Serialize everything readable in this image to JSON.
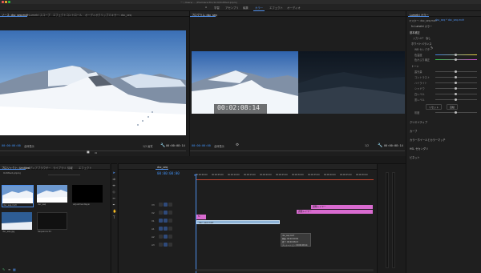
{
  "titlebar": {
    "title": "ー / Users/ ... /Premiere Pro/12.0/Untitled.prproj"
  },
  "workspaces": [
    {
      "label": "学習",
      "active": false
    },
    {
      "label": "アセンブリ",
      "active": false
    },
    {
      "label": "編集",
      "active": false
    },
    {
      "label": "カラー",
      "active": true
    },
    {
      "label": "エフェクト",
      "active": false
    },
    {
      "label": "オーディオ",
      "active": false
    }
  ],
  "source_panel": {
    "tabs": [
      "ソース: dsc_seq.mxfr",
      "Lumetri スコープ",
      "エフェクトコントロール",
      "オーディオクリップミキサー: dsc_seq"
    ],
    "timecode_in": "00:00:00:00",
    "fit_label": "全体表示",
    "timecode_out": "00:00:08:14",
    "zoom_label": "1/2 画質"
  },
  "program_panel": {
    "tabs": [
      "プログラム: dsc_seq"
    ],
    "overlay_timecode": "00:02:08:14",
    "timecode_in": "00:00:00:00",
    "fit_label": "全体表示",
    "zoom_label": "1/2",
    "timecode_out": "00:00:08:14"
  },
  "lumetri_panel": {
    "title": "Lumetri カラー",
    "source_label": "マスター: dsc_seq.mxfr",
    "clip_label": "dsc_seq * dsc_seq.mxfr",
    "fx_label": "fx Lumetri カラー",
    "section_basic": "基本補正",
    "lut_label": "入力 LUT",
    "lut_value": "なし",
    "white_balance": "ホワイトバランス",
    "wb_selector": "WB セレクター",
    "temp": "色温度",
    "tint": "色かぶり補正",
    "tone": "トーン",
    "exposure": "露光量",
    "contrast": "コントラスト",
    "highlights": "ハイライト",
    "shadows": "シャドウ",
    "whites": "白レベル",
    "blacks": "黒レベル",
    "reset": "リセット",
    "auto": "自動",
    "saturation": "彩度",
    "sections": [
      "クリエイティブ",
      "カーブ",
      "カラーホイールとカラーマッチ",
      "HSL セカンダリ",
      "ビネット"
    ]
  },
  "project_panel": {
    "tabs": [
      "プロジェクト: Untitled",
      "メディアブラウザー",
      "ライブラリ",
      "情報",
      "エフェクト"
    ],
    "path": "Untitled.prproj",
    "items": [
      {
        "name": "dsc_seq.mxfr",
        "duration": "8:14"
      },
      {
        "name": "dsc_seq",
        "duration": "8:14"
      },
      {
        "name": "adjustmentlayer",
        "duration": ""
      },
      {
        "name": "dsc_seq.jpg",
        "duration": ""
      },
      {
        "name": "Sequence 01",
        "duration": ""
      }
    ],
    "search_placeholder": ""
  },
  "timeline": {
    "tab": "dsc_seq",
    "timecode": "00:00:00:00",
    "ruler": [
      "00:00:00:00",
      "00:00:05:00",
      "00:00:10:00",
      "00:00:15:00",
      "00:00:20:00",
      "00:00:25:00",
      "00:00:30:00",
      "00:00:35:00",
      "00:00:40:00",
      "00:00:45:00",
      "00:00:50:00"
    ],
    "tracks": [
      "V3",
      "V2",
      "V1",
      "A1",
      "A2",
      "A3"
    ],
    "clips": [
      {
        "label": "fx",
        "track": "V2"
      },
      {
        "label": "dsc_seq.mxfr",
        "track": "V1"
      },
      {
        "label": "調整レイヤー",
        "track": "V3"
      },
      {
        "label": "調整レイヤー",
        "track": "V2"
      }
    ],
    "tooltip": [
      "dsc_seq.mxfr",
      "開始: 00:00:00:00",
      "終了: 00:00:08:13",
      "デュレーション: 00:00:08:14"
    ]
  },
  "colors": {
    "accent": "#4d8de8",
    "timecode": "#3f8ef0",
    "clip_video": "#8fb4d8",
    "clip_adjust": "#d96bd0",
    "playhead": "#4d8de8"
  }
}
